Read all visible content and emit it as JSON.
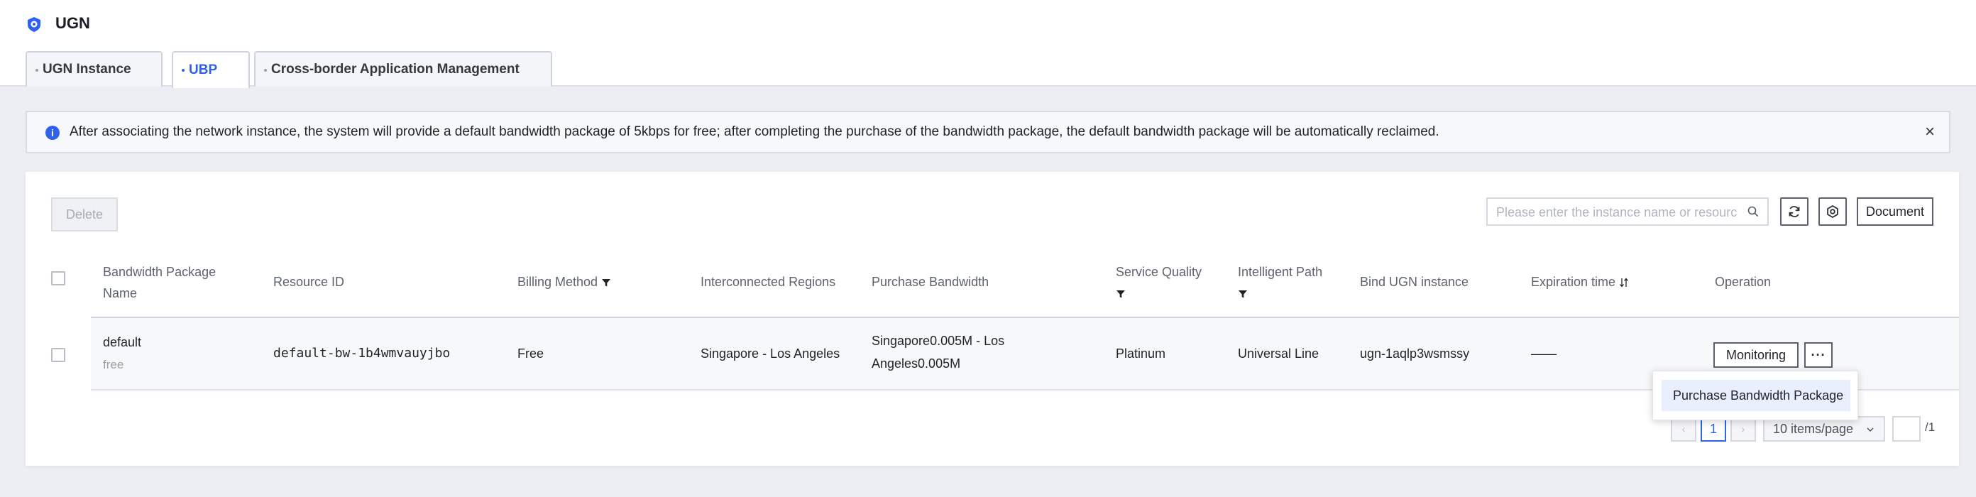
{
  "app": {
    "title": "UGN",
    "logo_icon": "cloud-shield-icon"
  },
  "tabs": [
    {
      "label": "UGN Instance",
      "active": false
    },
    {
      "label": "UBP",
      "active": true
    },
    {
      "label": "Cross-border Application Management",
      "active": false
    }
  ],
  "alert": {
    "text": "After associating the network instance, the system will provide a default bandwidth package of 5kbps for free; after completing the purchase of the bandwidth package, the default bandwidth package will be automatically reclaimed.",
    "close_label": "×"
  },
  "toolbar": {
    "delete_label": "Delete",
    "search_placeholder": "Please enter the instance name or resource ID",
    "document_label": "Document"
  },
  "table": {
    "headers": {
      "name_line1": "Bandwidth Package",
      "name_line2": "Name",
      "resource_id": "Resource ID",
      "billing_method": "Billing Method",
      "regions": "Interconnected Regions",
      "purchase_bandwidth": "Purchase Bandwidth",
      "service_quality": "Service Quality",
      "intelligent_path": "Intelligent Path",
      "bind_ugn": "Bind UGN instance",
      "expiration": "Expiration time",
      "operation": "Operation"
    },
    "rows": [
      {
        "name": "default",
        "name_sub": "free",
        "resource_id": "default-bw-1b4wmvauyjbo",
        "billing_method": "Free",
        "regions": "Singapore - Los Angeles",
        "bandwidth_line1": "Singapore0.005M - Los",
        "bandwidth_line2": "Angeles0.005M",
        "service_quality": "Platinum",
        "intelligent_path": "Universal Line",
        "bind_ugn": "ugn-1aqlp3wsmssy",
        "expiration": "——",
        "monitor_label": "Monitoring",
        "more_label": "···"
      }
    ]
  },
  "dropdown": {
    "item": "Purchase Bandwidth Package"
  },
  "pagination": {
    "prev": "‹",
    "current_page": "1",
    "next": "›",
    "page_size": "10 items/page",
    "jump_value": "",
    "total_pages": "/1"
  },
  "colors": {
    "accent": "#2e62ec",
    "page_bg": "#eceef4"
  }
}
